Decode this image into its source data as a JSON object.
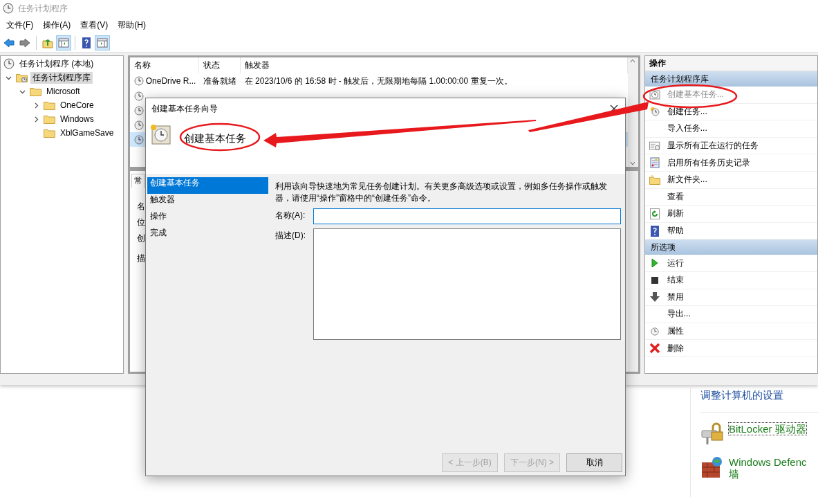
{
  "window": {
    "title": "任务计划程序"
  },
  "menu": [
    "文件(F)",
    "操作(A)",
    "查看(V)",
    "帮助(H)"
  ],
  "toolbar": [
    {
      "pressed": false
    },
    {
      "pressed": false
    },
    {
      "pressed": false
    },
    {
      "pressed": true
    },
    {
      "pressed": false
    },
    {
      "pressed": true
    }
  ],
  "tree": [
    {
      "label": "任务计划程序 (本地)",
      "selected": false,
      "children": [
        {
          "label": "任务计划程序库",
          "selected": true,
          "expanded": true,
          "children": [
            {
              "label": "Microsoft",
              "selected": false,
              "expanded": true,
              "children": [
                {
                  "label": "OneCore",
                  "selected": false,
                  "expanded": false
                },
                {
                  "label": "Windows",
                  "selected": false,
                  "expanded": false
                },
                {
                  "label": "XblGameSave",
                  "selected": false
                }
              ]
            }
          ]
        }
      ]
    }
  ],
  "task_list": {
    "columns": [
      "名称",
      "状态",
      "触发器"
    ],
    "rows": [
      {
        "name": "OneDrive R...",
        "status": "准备就绪",
        "trigger": "在 2023/10/6 的 16:58 时 - 触发后，无限期地每隔 1.00:00:00 重复一次。",
        "selected": false
      },
      {
        "selected": false
      },
      {
        "selected": false
      },
      {
        "selected": false
      },
      {
        "selected": true
      }
    ]
  },
  "detail_pane": {
    "tab": "常",
    "labels": [
      "名",
      "位",
      "创",
      "描"
    ]
  },
  "actions": {
    "title": "操作",
    "sections": [
      {
        "title": "任务计划程序库",
        "items": [
          {
            "label": "创建基本任务...",
            "disabled": true
          },
          {
            "label": "创建任务...",
            "disabled": false
          },
          {
            "label": "导入任务...",
            "disabled": false
          },
          {
            "label": "显示所有正在运行的任务",
            "disabled": false
          },
          {
            "label": "启用所有任务历史记录",
            "disabled": false
          },
          {
            "label": "新文件夹...",
            "disabled": false
          },
          {
            "label": "查看",
            "disabled": false
          },
          {
            "label": "刷新",
            "disabled": false
          },
          {
            "label": "帮助",
            "disabled": false
          }
        ]
      },
      {
        "title": "所选项",
        "items": [
          {
            "label": "运行",
            "disabled": false
          },
          {
            "label": "结束",
            "disabled": false
          },
          {
            "label": "禁用",
            "disabled": false
          },
          {
            "label": "导出...",
            "disabled": false
          },
          {
            "label": "属性",
            "disabled": false
          },
          {
            "label": "删除",
            "disabled": false
          }
        ]
      }
    ]
  },
  "dialog": {
    "title": "创建基本任务向导",
    "heading": "创建基本任务",
    "steps": [
      {
        "label": "创建基本任务",
        "selected": true
      },
      {
        "label": "触发器",
        "selected": false
      },
      {
        "label": "操作",
        "selected": false
      },
      {
        "label": "完成",
        "selected": false
      }
    ],
    "intro": "利用该向导快速地为常见任务创建计划。有关更多高级选项或设置，例如多任务操作或触发器，请使用“操作”窗格中的“创建任务”命令。",
    "fields": [
      {
        "label": "名称(A):",
        "kind": "line"
      },
      {
        "label": "描述(D):",
        "kind": "area"
      }
    ],
    "buttons": [
      {
        "label": "< 上一步(B)",
        "disabled": true
      },
      {
        "label": "下一步(N) >",
        "disabled": true
      },
      {
        "label": "取消",
        "disabled": false
      }
    ]
  },
  "behind": {
    "link": "调整计算机的设置",
    "items": [
      {
        "lines": [
          "BitLocker 驱动器"
        ],
        "focused": true
      },
      {
        "lines": [
          "Windows Defenc",
          "墙"
        ],
        "focused": false
      }
    ]
  },
  "annotations": [
    {
      "kind": "ellipse"
    },
    {
      "kind": "ellipse"
    },
    {
      "kind": "arrow"
    }
  ]
}
